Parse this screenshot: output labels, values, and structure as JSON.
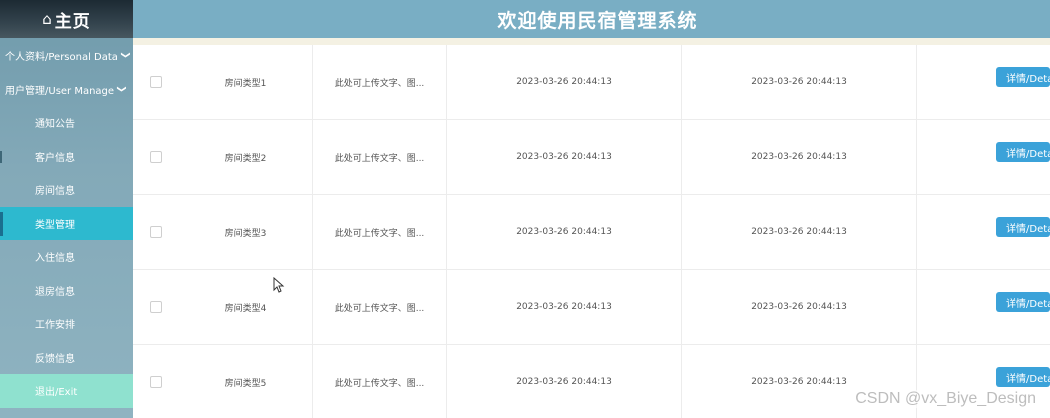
{
  "sidebar": {
    "home_icon": "⌂",
    "home_label": "主页",
    "groups": [
      {
        "label": "个人资料/Personal Data",
        "chevron": "❯"
      },
      {
        "label": "用户管理/User Manage",
        "chevron": "❯"
      }
    ],
    "items": [
      {
        "label": "通知公告"
      },
      {
        "label": "客户信息"
      },
      {
        "label": "房间信息"
      },
      {
        "label": "类型管理"
      },
      {
        "label": "入住信息"
      },
      {
        "label": "退房信息"
      },
      {
        "label": "工作安排"
      },
      {
        "label": "反馈信息"
      },
      {
        "label": "退出/Exit"
      }
    ],
    "active_item": "类型管理",
    "colors": {
      "active": "#2db9cf",
      "exit": "#8fe1cf"
    }
  },
  "header": {
    "title": "欢迎使用民宿管理系统",
    "color": "#79aec4"
  },
  "table": {
    "rows": [
      {
        "type": "房间类型1",
        "desc": "此处可上传文字、图...",
        "time1": "2023-03-26 20:44:13",
        "time2": "2023-03-26 20:44:13",
        "action": "详情/Details"
      },
      {
        "type": "房间类型2",
        "desc": "此处可上传文字、图...",
        "time1": "2023-03-26 20:44:13",
        "time2": "2023-03-26 20:44:13",
        "action": "详情/Details"
      },
      {
        "type": "房间类型3",
        "desc": "此处可上传文字、图...",
        "time1": "2023-03-26 20:44:13",
        "time2": "2023-03-26 20:44:13",
        "action": "详情/Details"
      },
      {
        "type": "房间类型4",
        "desc": "此处可上传文字、图...",
        "time1": "2023-03-26 20:44:13",
        "time2": "2023-03-26 20:44:13",
        "action": "详情/Details"
      },
      {
        "type": "房间类型5",
        "desc": "此处可上传文字、图...",
        "time1": "2023-03-26 20:44:13",
        "time2": "2023-03-26 20:44:13",
        "action": "详情/Details"
      }
    ],
    "button_color": "#3ba2d9"
  },
  "watermark": "CSDN @vx_Biye_Design"
}
